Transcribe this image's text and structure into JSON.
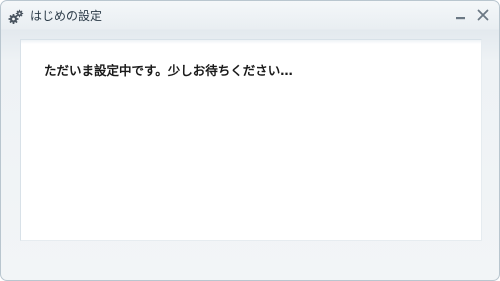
{
  "window": {
    "title": "はじめの設定",
    "title_icon": "gears-icon",
    "minimize_icon": "minimize-icon",
    "close_icon": "close-icon"
  },
  "content": {
    "status_message": "ただいま設定中です。少しお待ちください…"
  },
  "colors": {
    "title_text": "#2a3a47",
    "window_border": "#b9c6cf",
    "panel_background": "#ffffff",
    "panel_border": "#d8e1e8",
    "icon_color": "#4a5560",
    "button_color": "#6b7884"
  }
}
